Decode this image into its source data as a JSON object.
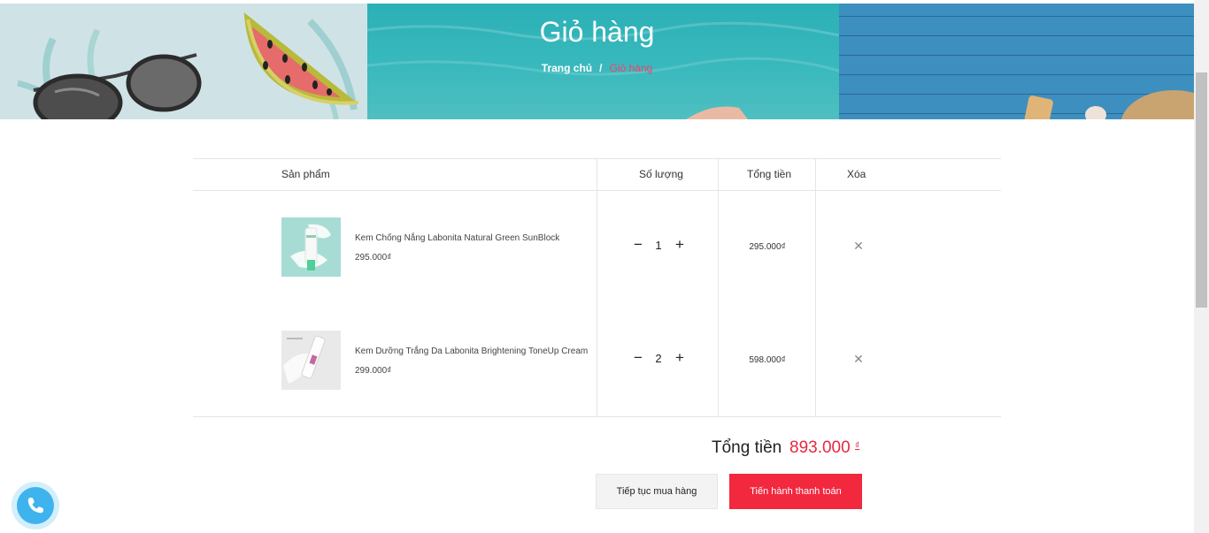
{
  "banner": {
    "title": "Giỏ hàng",
    "breadcrumb_home": "Trang chủ",
    "breadcrumb_sep": "/",
    "breadcrumb_current": "Giỏ hàng"
  },
  "table": {
    "headers": {
      "product": "Sản phẩm",
      "quantity": "Số lượng",
      "total": "Tổng tiền",
      "remove": "Xóa"
    },
    "rows": [
      {
        "name": "Kem Chống Nắng Labonita Natural Green SunBlock",
        "price": "295.000₫",
        "quantity": "1",
        "total": "295.000₫"
      },
      {
        "name": "Kem Dưỡng Trắng Da Labonita Brightening ToneUp Cream",
        "price": "299.000₫",
        "quantity": "2",
        "total": "598.000₫"
      }
    ],
    "minus_symbol": "−",
    "plus_symbol": "+",
    "remove_symbol": "✕"
  },
  "summary": {
    "label": "Tổng tiền",
    "value": "893.000",
    "currency": "₫"
  },
  "buttons": {
    "continue": "Tiếp tục mua hàng",
    "checkout": "Tiến hành thanh toán"
  },
  "colors": {
    "accent": "#f2283f",
    "phone": "#3fb3ee"
  },
  "icons": {
    "phone": "phone-icon",
    "remove": "close-icon"
  }
}
